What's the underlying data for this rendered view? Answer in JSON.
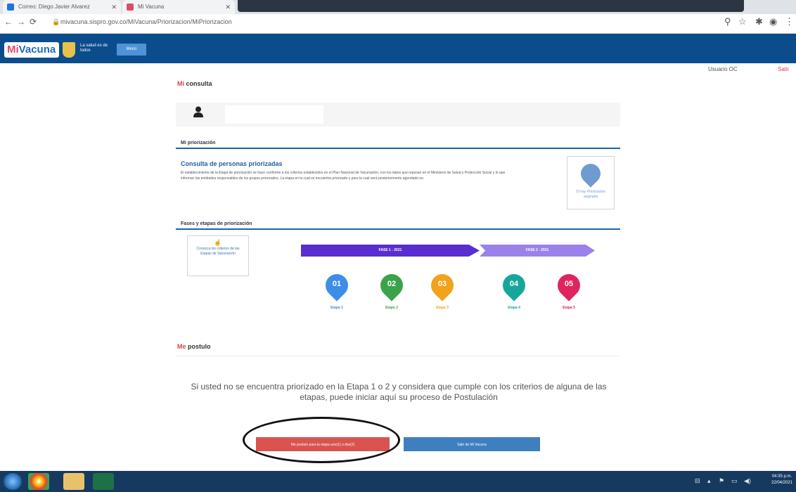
{
  "browser": {
    "tabs": [
      {
        "title": "Correo: Diego Javier Alvarez"
      },
      {
        "title": "Mi Vacuna"
      }
    ],
    "url": "mivacuna.sispro.gov.co/MiVacuna/Priorizacion/MiPriorizacion"
  },
  "header": {
    "logo_mi": "Mi",
    "logo_vacuna": "Vacuna",
    "ministry": "La salud es de todos",
    "menu_button": "Menú",
    "user": "Usuario OC",
    "logout": "Salir"
  },
  "consulta": {
    "title_initial": "Mi",
    "title_rest": " consulta"
  },
  "priorizacion": {
    "section_label": "Mi priorización",
    "title": "Consulta de personas priorizadas",
    "body": "El establecimiento de la Etapa de priorización se hace conforme a los criterios establecidos en el Plan Nacional de Vacunación, con los datos que reposan en el Ministerio de Salud y Protección Social y lo que informan las entidades responsables de los grupos priorizados. La etapa en la cual se encuentra priorizado y para la cual será posteriormente agendado es:",
    "card_text": "Sí hay Priorización asignada"
  },
  "fases": {
    "section_label": "Fases y etapas de priorización",
    "criteria_text": "Conozca los criterios de las Etapas de Vacunación",
    "fase1": "FASE 1 - 2021",
    "fase2": "FASE 2 - 2021",
    "etapas": [
      {
        "num": "01",
        "label": "Etapa 1",
        "color": "#3d8ee6"
      },
      {
        "num": "02",
        "label": "Etapa 2",
        "color": "#3aa34a"
      },
      {
        "num": "03",
        "label": "Etapa 3",
        "color": "#f2a21b"
      },
      {
        "num": "04",
        "label": "Etapa 4",
        "color": "#17a79a"
      },
      {
        "num": "05",
        "label": "Etapa 5",
        "color": "#e0245e"
      }
    ]
  },
  "postulacion": {
    "title_initial": "Me",
    "title_rest": " postulo",
    "message": "Si usted no se encuentra priorizado en la Etapa 1 o 2 y considera que cumple con los criterios de alguna de las etapas, puede iniciar aquí su proceso de Postulación",
    "btn_postular": "Me postulo para la etapa uno(1) o dos(2)",
    "btn_salir": "Salir de Mi Vacuna"
  },
  "taskbar": {
    "time": "04:35 p.m.",
    "date": "22/04/2021"
  }
}
